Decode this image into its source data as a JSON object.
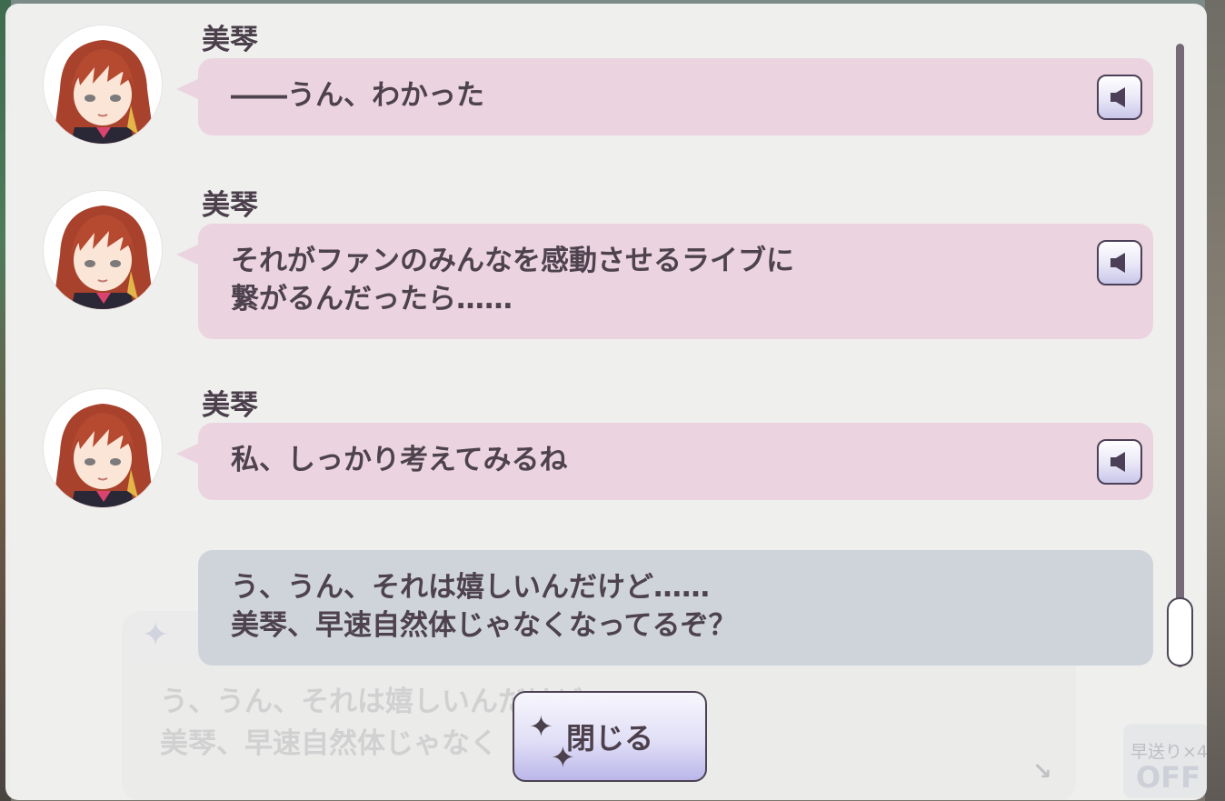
{
  "background_echo": {
    "lines": [
      "う、うん、それは嬉しいんだけど",
      "美琴、早速自然体じゃなく"
    ],
    "fast_forward_label": "早送り×4",
    "fast_forward_state": "OFF"
  },
  "log": [
    {
      "speaker": "美琴",
      "lines": [
        "――うん、わかった"
      ],
      "has_voice": true
    },
    {
      "speaker": "美琴",
      "lines": [
        "それがファンのみんなを感動させるライブに",
        "繋がるんだったら……"
      ],
      "has_voice": true
    },
    {
      "speaker": "美琴",
      "lines": [
        "私、しっかり考えてみるね"
      ],
      "has_voice": true
    },
    {
      "speaker": "",
      "lines": [
        "う、うん、それは嬉しいんだけど……",
        "美琴、早速自然体じゃなくなってるぞ？"
      ],
      "has_voice": false
    }
  ],
  "close_button": {
    "label": "閉じる"
  },
  "colors": {
    "pink_bubble": "#ebd4df",
    "gray_bubble": "#cfd4da",
    "text": "#4d424d"
  }
}
